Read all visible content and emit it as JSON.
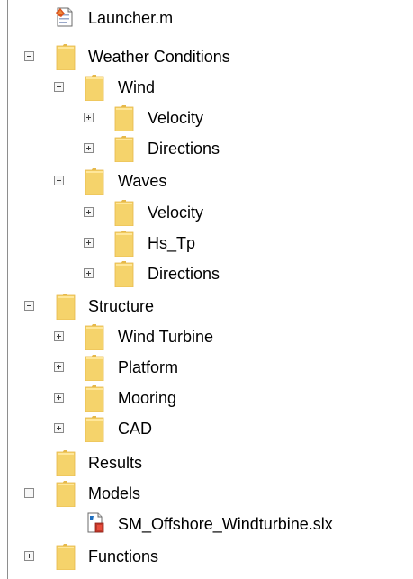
{
  "tree": {
    "items": [
      {
        "label": "Launcher.m",
        "icon": "matlab-script-icon",
        "toggle": "none",
        "level": 2
      },
      {
        "label": "Weather Conditions",
        "icon": "folder-icon",
        "toggle": "minus",
        "level": 1
      },
      {
        "label": "Wind",
        "icon": "folder-icon",
        "toggle": "minus",
        "level": 2
      },
      {
        "label": "Velocity",
        "icon": "folder-icon",
        "toggle": "plus",
        "level": 3
      },
      {
        "label": "Directions",
        "icon": "folder-icon",
        "toggle": "plus",
        "level": 3
      },
      {
        "label": "Waves",
        "icon": "folder-icon",
        "toggle": "minus",
        "level": 2
      },
      {
        "label": "Velocity",
        "icon": "folder-icon",
        "toggle": "plus",
        "level": 3
      },
      {
        "label": "Hs_Tp",
        "icon": "folder-icon",
        "toggle": "plus",
        "level": 3
      },
      {
        "label": "Directions",
        "icon": "folder-icon",
        "toggle": "plus",
        "level": 3
      },
      {
        "label": "Structure",
        "icon": "folder-icon",
        "toggle": "minus",
        "level": 1
      },
      {
        "label": "Wind Turbine",
        "icon": "folder-icon",
        "toggle": "plus",
        "level": 2
      },
      {
        "label": "Platform",
        "icon": "folder-icon",
        "toggle": "plus",
        "level": 2
      },
      {
        "label": "Mooring",
        "icon": "folder-icon",
        "toggle": "plus",
        "level": 2
      },
      {
        "label": "CAD",
        "icon": "folder-icon",
        "toggle": "plus",
        "level": 2
      },
      {
        "label": "Results",
        "icon": "folder-icon",
        "toggle": "none",
        "level": 1
      },
      {
        "label": "Models",
        "icon": "folder-icon",
        "toggle": "minus",
        "level": 1
      },
      {
        "label": "SM_Offshore_Windturbine.slx",
        "icon": "simulink-model-icon",
        "toggle": "none",
        "level": 3
      },
      {
        "label": "Functions",
        "icon": "folder-icon",
        "toggle": "plus",
        "level": 1
      }
    ]
  },
  "colors": {
    "folder": "#f5d36b",
    "folder_edge": "#e6b94a",
    "border": "#8e8e8e"
  }
}
